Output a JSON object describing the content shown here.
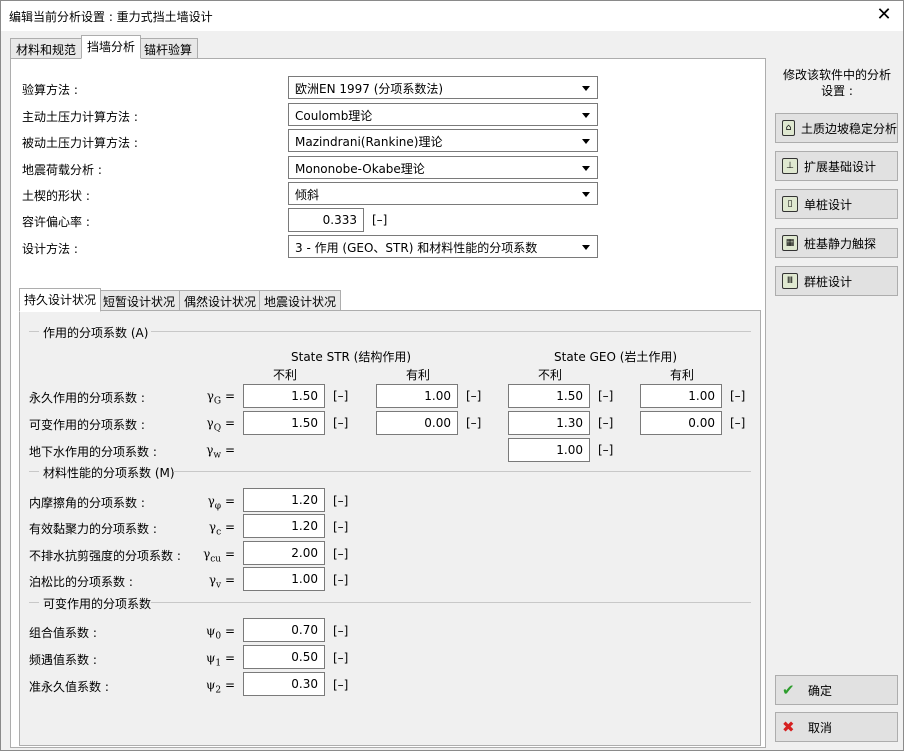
{
  "window": {
    "title": "编辑当前分析设置 : 重力式挡土墙设计",
    "close_glyph": "✕"
  },
  "top_tabs": [
    "材料和规范",
    "挡墙分析",
    "锚杆验算"
  ],
  "settings": [
    {
      "label": "验算方法 :",
      "value": "欧洲EN 1997 (分项系数法)"
    },
    {
      "label": "主动土压力计算方法 :",
      "value": "Coulomb理论"
    },
    {
      "label": "被动土压力计算方法 :",
      "value": "Mazindrani(Rankine)理论"
    },
    {
      "label": "地震荷载分析 :",
      "value": "Mononobe-Okabe理论"
    },
    {
      "label": "土楔的形状 :",
      "value": "倾斜"
    }
  ],
  "eccentricity": {
    "label": "容许偏心率 :",
    "value": "0.333",
    "unit": "[–]"
  },
  "design_method": {
    "label": "设计方法 :",
    "value": "3 - 作用 (GEO、STR) 和材料性能的分项系数"
  },
  "inner_tabs": [
    "持久设计状况",
    "短暂设计状况",
    "偶然设计状况",
    "地震设计状况"
  ],
  "actions": {
    "section": "作用的分项系数 (A)",
    "str_header": "State STR (结构作用)",
    "geo_header": "State GEO (岩土作用)",
    "unfav": "不利",
    "fav": "有利",
    "rows": [
      {
        "label": "永久作用的分项系数 :",
        "sym": "γ",
        "sub": "G",
        "values": [
          "1.50",
          "1.00",
          "1.50",
          "1.00"
        ]
      },
      {
        "label": "可变作用的分项系数 :",
        "sym": "γ",
        "sub": "Q",
        "values": [
          "1.50",
          "0.00",
          "1.30",
          "0.00"
        ]
      },
      {
        "label": "地下水作用的分项系数 :",
        "sym": "γ",
        "sub": "w",
        "values": [
          "1.00"
        ]
      }
    ]
  },
  "material": {
    "section": "材料性能的分项系数 (M)",
    "rows": [
      {
        "label": "内摩擦角的分项系数 :",
        "sym": "γ",
        "sub": "φ",
        "value": "1.20"
      },
      {
        "label": "有效黏聚力的分项系数 :",
        "sym": "γ",
        "sub": "c",
        "value": "1.20"
      },
      {
        "label": "不排水抗剪强度的分项系数 :",
        "sym": "γ",
        "sub": "cu",
        "value": "2.00"
      },
      {
        "label": "泊松比的分项系数 :",
        "sym": "γ",
        "sub": "v",
        "value": "1.00"
      }
    ]
  },
  "variable": {
    "section": "可变作用的分项系数",
    "rows": [
      {
        "label": "组合值系数 :",
        "sym": "ψ",
        "sub": "0",
        "value": "0.70"
      },
      {
        "label": "频遇值系数 :",
        "sym": "ψ",
        "sub": "1",
        "value": "0.50"
      },
      {
        "label": "准永久值系数 :",
        "sym": "ψ",
        "sub": "2",
        "value": "0.30"
      }
    ]
  },
  "unit": "[–]",
  "eq": "=",
  "sidebar": {
    "note": "修改该软件中的分析设置 :",
    "buttons": [
      "土质边坡稳定分析",
      "扩展基础设计",
      "单桩设计",
      "桩基静力触探",
      "群桩设计"
    ],
    "ok": "确定",
    "cancel": "取消"
  },
  "colors": {
    "ok_icon": "#2e9e2e",
    "cancel_icon": "#d62020"
  }
}
